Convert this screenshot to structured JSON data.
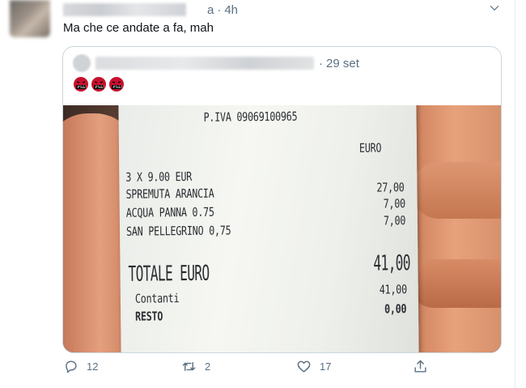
{
  "tweet": {
    "handle_tail": "a",
    "separator": "·",
    "time": "4h",
    "text": "Ma che ce andate a fa, mah",
    "avatar_icon": "blurred-avatar",
    "menu_icon": "chevron-down-icon"
  },
  "quoted_tweet": {
    "separator": "·",
    "date": "29 set",
    "emojis": [
      "face-with-symbols-on-mouth",
      "face-with-symbols-on-mouth",
      "face-with-symbols-on-mouth"
    ],
    "receipt": {
      "piva": "P.IVA 09069100965",
      "currency_header": "EURO",
      "lines": [
        {
          "label": "3 X 9.00 EUR",
          "amount": ""
        },
        {
          "label": "SPREMUTA ARANCIA",
          "amount": "27,00"
        },
        {
          "label": "ACQUA PANNA 0.75",
          "amount": "7,00"
        },
        {
          "label": "SAN PELLEGRINO 0,75",
          "amount": "7,00"
        }
      ],
      "total_label": "TOTALE EURO",
      "total_amount": "41,00",
      "cash_label": "Contanti",
      "cash_amount": "41,00",
      "change_label": "RESTO",
      "change_amount": "0,00"
    }
  },
  "actions": {
    "reply": {
      "icon": "reply-icon",
      "count": "12"
    },
    "retweet": {
      "icon": "retweet-icon",
      "count": "2"
    },
    "like": {
      "icon": "heart-icon",
      "count": "17"
    },
    "share": {
      "icon": "share-icon",
      "count": ""
    }
  },
  "colors": {
    "secondary_text": "#5b7083",
    "border": "#ccd6dd",
    "emoji_red": "#c8102e"
  }
}
